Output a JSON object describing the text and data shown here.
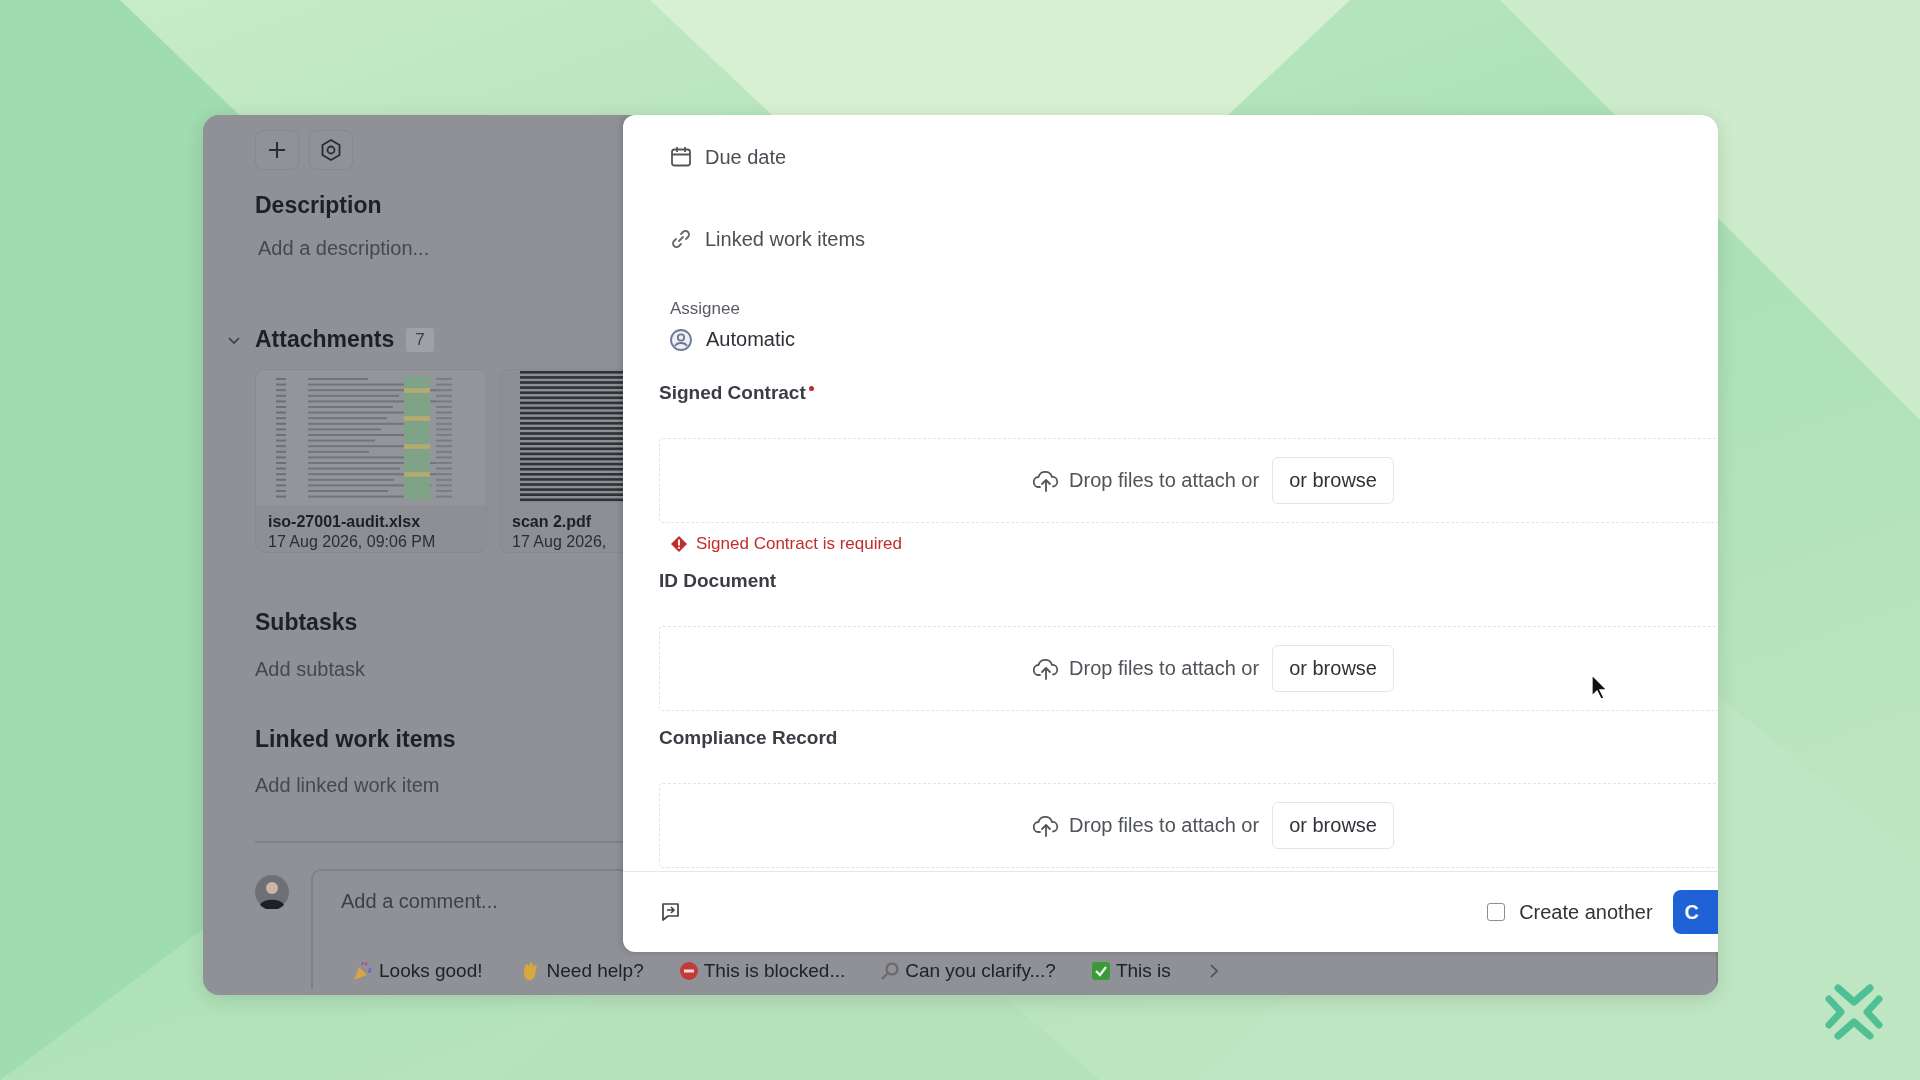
{
  "page": {
    "description": {
      "heading": "Description",
      "placeholder": "Add a description..."
    },
    "attachments": {
      "heading": "Attachments",
      "count": "7",
      "expanded": true,
      "files": [
        {
          "kind": "spreadsheet",
          "name": "iso-27001-audit.xlsx",
          "date": "17 Aug 2026, 09:06 PM"
        },
        {
          "kind": "scan",
          "name": "scan 2.pdf",
          "date": "17 Aug 2026,"
        }
      ]
    },
    "subtasks": {
      "heading": "Subtasks",
      "action": "Add subtask"
    },
    "linked_work_items": {
      "heading": "Linked work items",
      "action": "Add linked work item"
    },
    "comment": {
      "placeholder": "Add a comment...",
      "reactions": [
        {
          "kind": "party",
          "label": "Looks good!"
        },
        {
          "kind": "hand",
          "label": "Need help?"
        },
        {
          "kind": "stop",
          "label": "This is blocked..."
        },
        {
          "kind": "search",
          "label": "Can you clarify...?"
        },
        {
          "kind": "check",
          "label": "This is"
        }
      ]
    }
  },
  "modal": {
    "fields": [
      {
        "kind": "date",
        "label": "Due date"
      },
      {
        "kind": "link",
        "label": "Linked work items"
      }
    ],
    "assignee": {
      "label": "Assignee",
      "value": "Automatic"
    },
    "uploads": [
      {
        "label": "Signed Contract",
        "required": true,
        "prompt": "Drop files to attach or",
        "button": "or browse",
        "error": "Signed Contract is required"
      },
      {
        "label": "ID Document",
        "required": false,
        "prompt": "Drop files to attach or",
        "button": "or browse"
      },
      {
        "label": "Compliance Record",
        "required": false,
        "prompt": "Drop files to attach or",
        "button": "or browse"
      }
    ],
    "footer": {
      "create_another": {
        "label": "Create another",
        "checked": false
      },
      "submit": "C"
    }
  }
}
